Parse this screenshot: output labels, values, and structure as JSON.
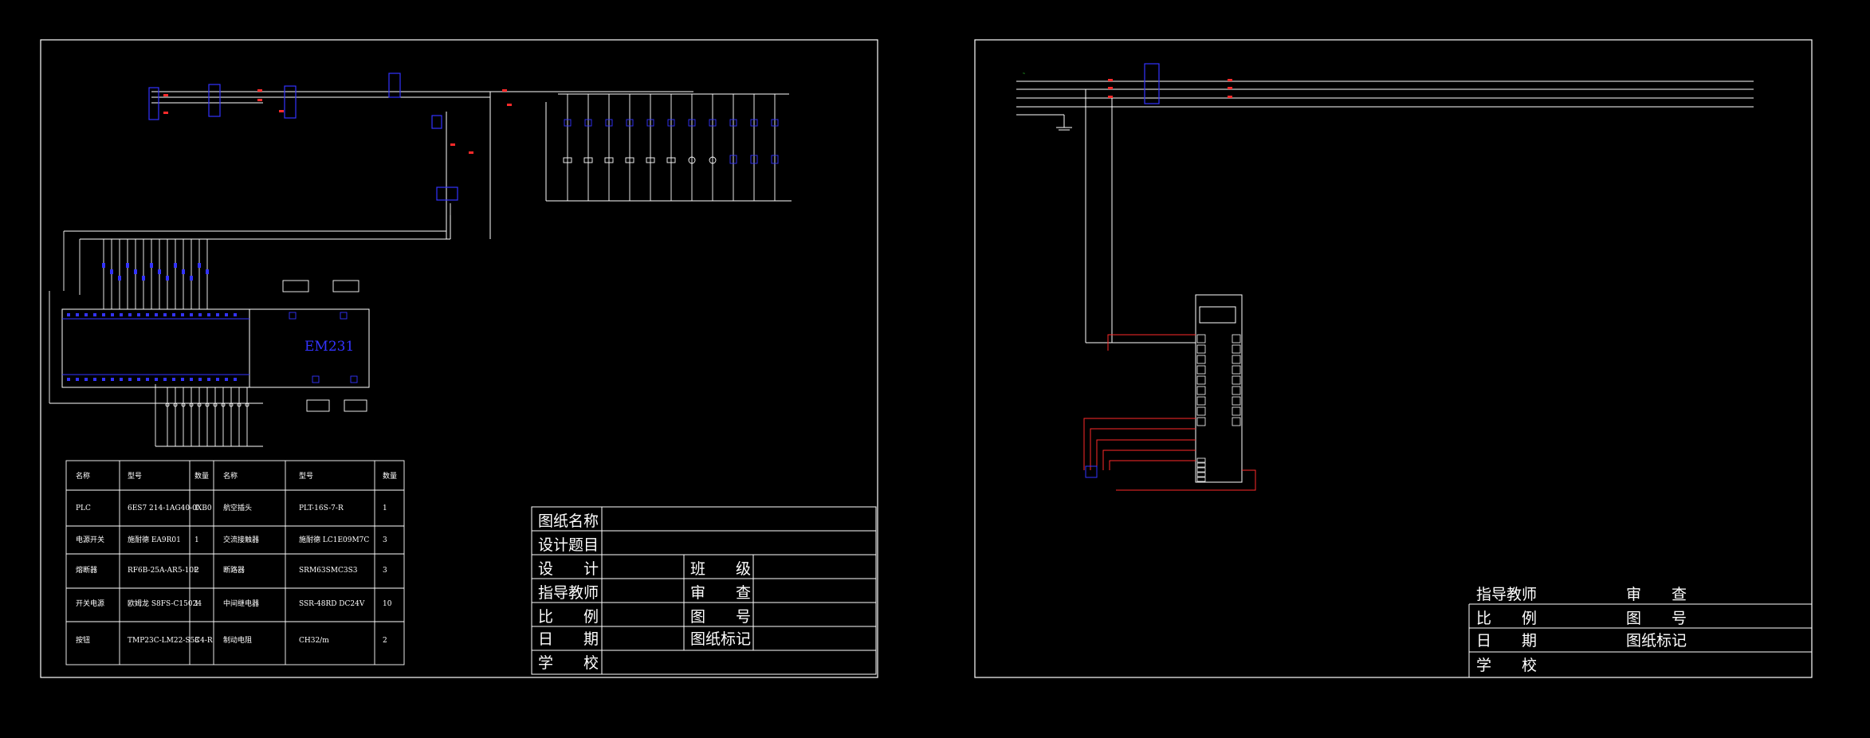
{
  "sheet1": {
    "module_label": "EM231",
    "components_table": {
      "headers": [
        "名称",
        "型号",
        "数量",
        "名称",
        "型号",
        "数量"
      ],
      "rows": [
        [
          "PLC",
          "6ES7 214-1AG40-0XB0",
          "1",
          "航空插头",
          "PLT-16S-7-R",
          "1"
        ],
        [
          "电源开关",
          "施耐德 EA9R01",
          "1",
          "交流接触器",
          "施耐德 LC1E09M7C",
          "3"
        ],
        [
          "熔断器",
          "RF6B-25A-AR5-10P",
          "2",
          "断路器",
          "SRM63SMC3S3",
          "3"
        ],
        [
          "开关电源",
          "欧姆龙 S8FS-C15024",
          "1",
          "中间继电器",
          "SSR-48RD DC24V",
          "10"
        ],
        [
          "按钮",
          "TMP23C-LM22-S5C4-R",
          "3",
          "制动电阻",
          "CH32/m",
          "2"
        ]
      ]
    },
    "title_block": {
      "drawing_name": "图纸名称",
      "design_topic": "设计题目",
      "design": "设　　计",
      "class": "班　　级",
      "instructor": "指导教师",
      "review": "审　　查",
      "scale": "比　　例",
      "drawing_no": "图　　号",
      "date": "日　　期",
      "drawing_mark": "图纸标记",
      "school": "学　　校"
    }
  },
  "sheet2": {
    "title_block": {
      "instructor": "指导教师",
      "review": "审　　查",
      "scale": "比　　例",
      "drawing_no": "图　　号",
      "date": "日　　期",
      "drawing_mark": "图纸标记",
      "school": "学　　校"
    }
  },
  "colors": {
    "background": "#000000",
    "frame": "#ffffff",
    "wire": "#ffffff",
    "component": "#3333ff",
    "label_red": "#ff2a2a",
    "label_green": "#33ff33"
  }
}
